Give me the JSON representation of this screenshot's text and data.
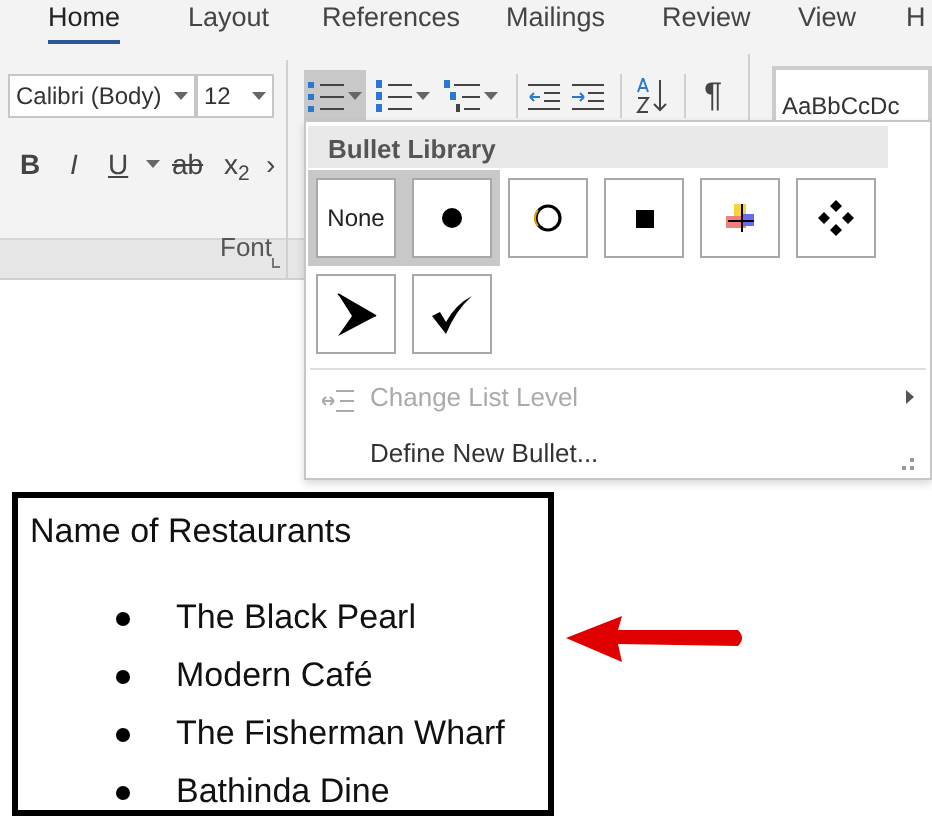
{
  "tabs": [
    {
      "label": "Home",
      "selected": true
    },
    {
      "label": "Layout",
      "selected": false
    },
    {
      "label": "References",
      "selected": false
    },
    {
      "label": "Mailings",
      "selected": false
    },
    {
      "label": "Review",
      "selected": false
    },
    {
      "label": "View",
      "selected": false
    },
    {
      "label": "H",
      "selected": false
    }
  ],
  "font": {
    "name": "Calibri (Body)",
    "size": "12",
    "group_label": "Font"
  },
  "format_buttons": [
    {
      "kind": "bold",
      "label": "B"
    },
    {
      "kind": "italic",
      "label": "I"
    },
    {
      "kind": "underline",
      "label": "U"
    },
    {
      "kind": "strike",
      "label": "ab"
    },
    {
      "kind": "subscript",
      "label": "x$_{2}$"
    },
    {
      "kind": "more",
      "label": "›"
    }
  ],
  "paragraph": {
    "pilcrow": "¶"
  },
  "styles_gallery": {
    "sample": "AaBbCcDc"
  },
  "bullet_menu": {
    "title": "Bullet Library",
    "bullets": [
      {
        "kind": "none",
        "label": "None",
        "highlighted": true
      },
      {
        "kind": "disc",
        "highlighted": true
      },
      {
        "kind": "circle",
        "highlighted": false
      },
      {
        "kind": "square",
        "highlighted": false
      },
      {
        "kind": "cross",
        "highlighted": false
      },
      {
        "kind": "diamonds",
        "highlighted": false
      },
      {
        "kind": "arrowhead",
        "highlighted": false
      },
      {
        "kind": "check",
        "highlighted": false
      }
    ],
    "items": [
      {
        "label": "Change List Level",
        "disabled": true,
        "submenu": true
      },
      {
        "label": "Define New Bullet...",
        "disabled": false,
        "submenu": false
      }
    ]
  },
  "document": {
    "heading": "Name of Restaurants",
    "list": [
      "The Black Pearl",
      "Modern Café",
      "The Fisherman Wharf",
      "Bathinda Dine"
    ]
  }
}
